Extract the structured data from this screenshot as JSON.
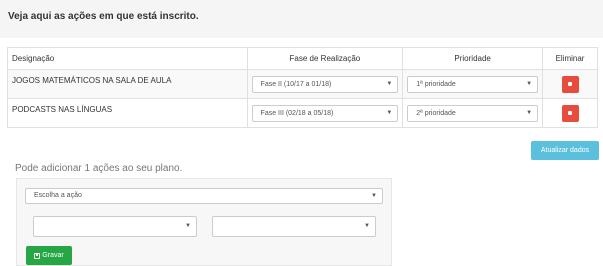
{
  "heading": "Veja aqui as ações em que está inscrito.",
  "table": {
    "headers": {
      "designation": "Designação",
      "phase": "Fase de Realização",
      "priority": "Prioridade",
      "delete": "Eliminar"
    },
    "rows": [
      {
        "designation": "JOGOS MATEMÁTICOS NA SALA DE AULA",
        "phase": "Fase II (10/17 a 01/18)",
        "priority": "1ª prioridade"
      },
      {
        "designation": "PODCASTS NAS LÍNGUAS",
        "phase": "Fase III (02/18 a 05/18)",
        "priority": "2ª prioridade"
      }
    ]
  },
  "update_button": "Atualizar dados",
  "add_section": {
    "label": "Pode adicionar 1 ações ao seu plano.",
    "choose_action": "Escolha a ação",
    "select_a": "",
    "select_b": "",
    "save_button": "Gravar"
  },
  "colors": {
    "delete": "#e74c3c",
    "update": "#5bc0de",
    "save": "#27a744"
  },
  "icons": {
    "caret": "chevron-down-icon",
    "delete": "trash-icon",
    "save": "floppy-icon"
  }
}
